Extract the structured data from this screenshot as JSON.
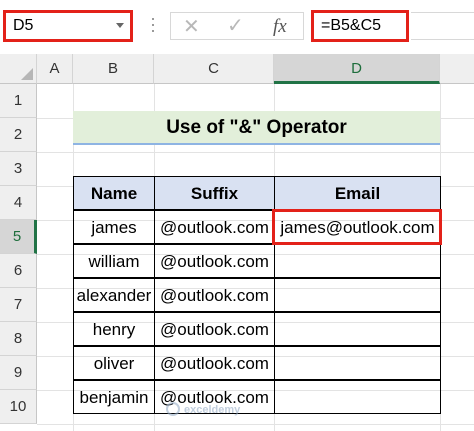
{
  "formula_bar": {
    "name_box": "D5",
    "cancel_glyph": "✕",
    "enter_glyph": "✓",
    "fx_label": "fx",
    "formula": "=B5&C5"
  },
  "columns": [
    "A",
    "B",
    "C",
    "D"
  ],
  "rows": [
    "1",
    "2",
    "3",
    "4",
    "5",
    "6",
    "7",
    "8",
    "9",
    "10"
  ],
  "sheet": {
    "title": "Use of \"&\" Operator",
    "headers": {
      "name": "Name",
      "suffix": "Suffix",
      "email": "Email"
    },
    "records": [
      {
        "name": "james",
        "suffix": "@outlook.com",
        "email": "james@outlook.com"
      },
      {
        "name": "william",
        "suffix": "@outlook.com",
        "email": ""
      },
      {
        "name": "alexander",
        "suffix": "@outlook.com",
        "email": ""
      },
      {
        "name": "henry",
        "suffix": "@outlook.com",
        "email": ""
      },
      {
        "name": "oliver",
        "suffix": "@outlook.com",
        "email": ""
      },
      {
        "name": "benjamin",
        "suffix": "@outlook.com",
        "email": ""
      }
    ]
  },
  "watermark": "exceldemy",
  "icons": {
    "dropdown": "chevron-down-icon",
    "cancel": "close-icon",
    "enter": "check-icon",
    "function": "fx-icon"
  },
  "colors": {
    "highlight": "#e32119",
    "title_fill": "#e2efda",
    "header_fill": "#d9e1f2",
    "excel_green": "#217346"
  }
}
